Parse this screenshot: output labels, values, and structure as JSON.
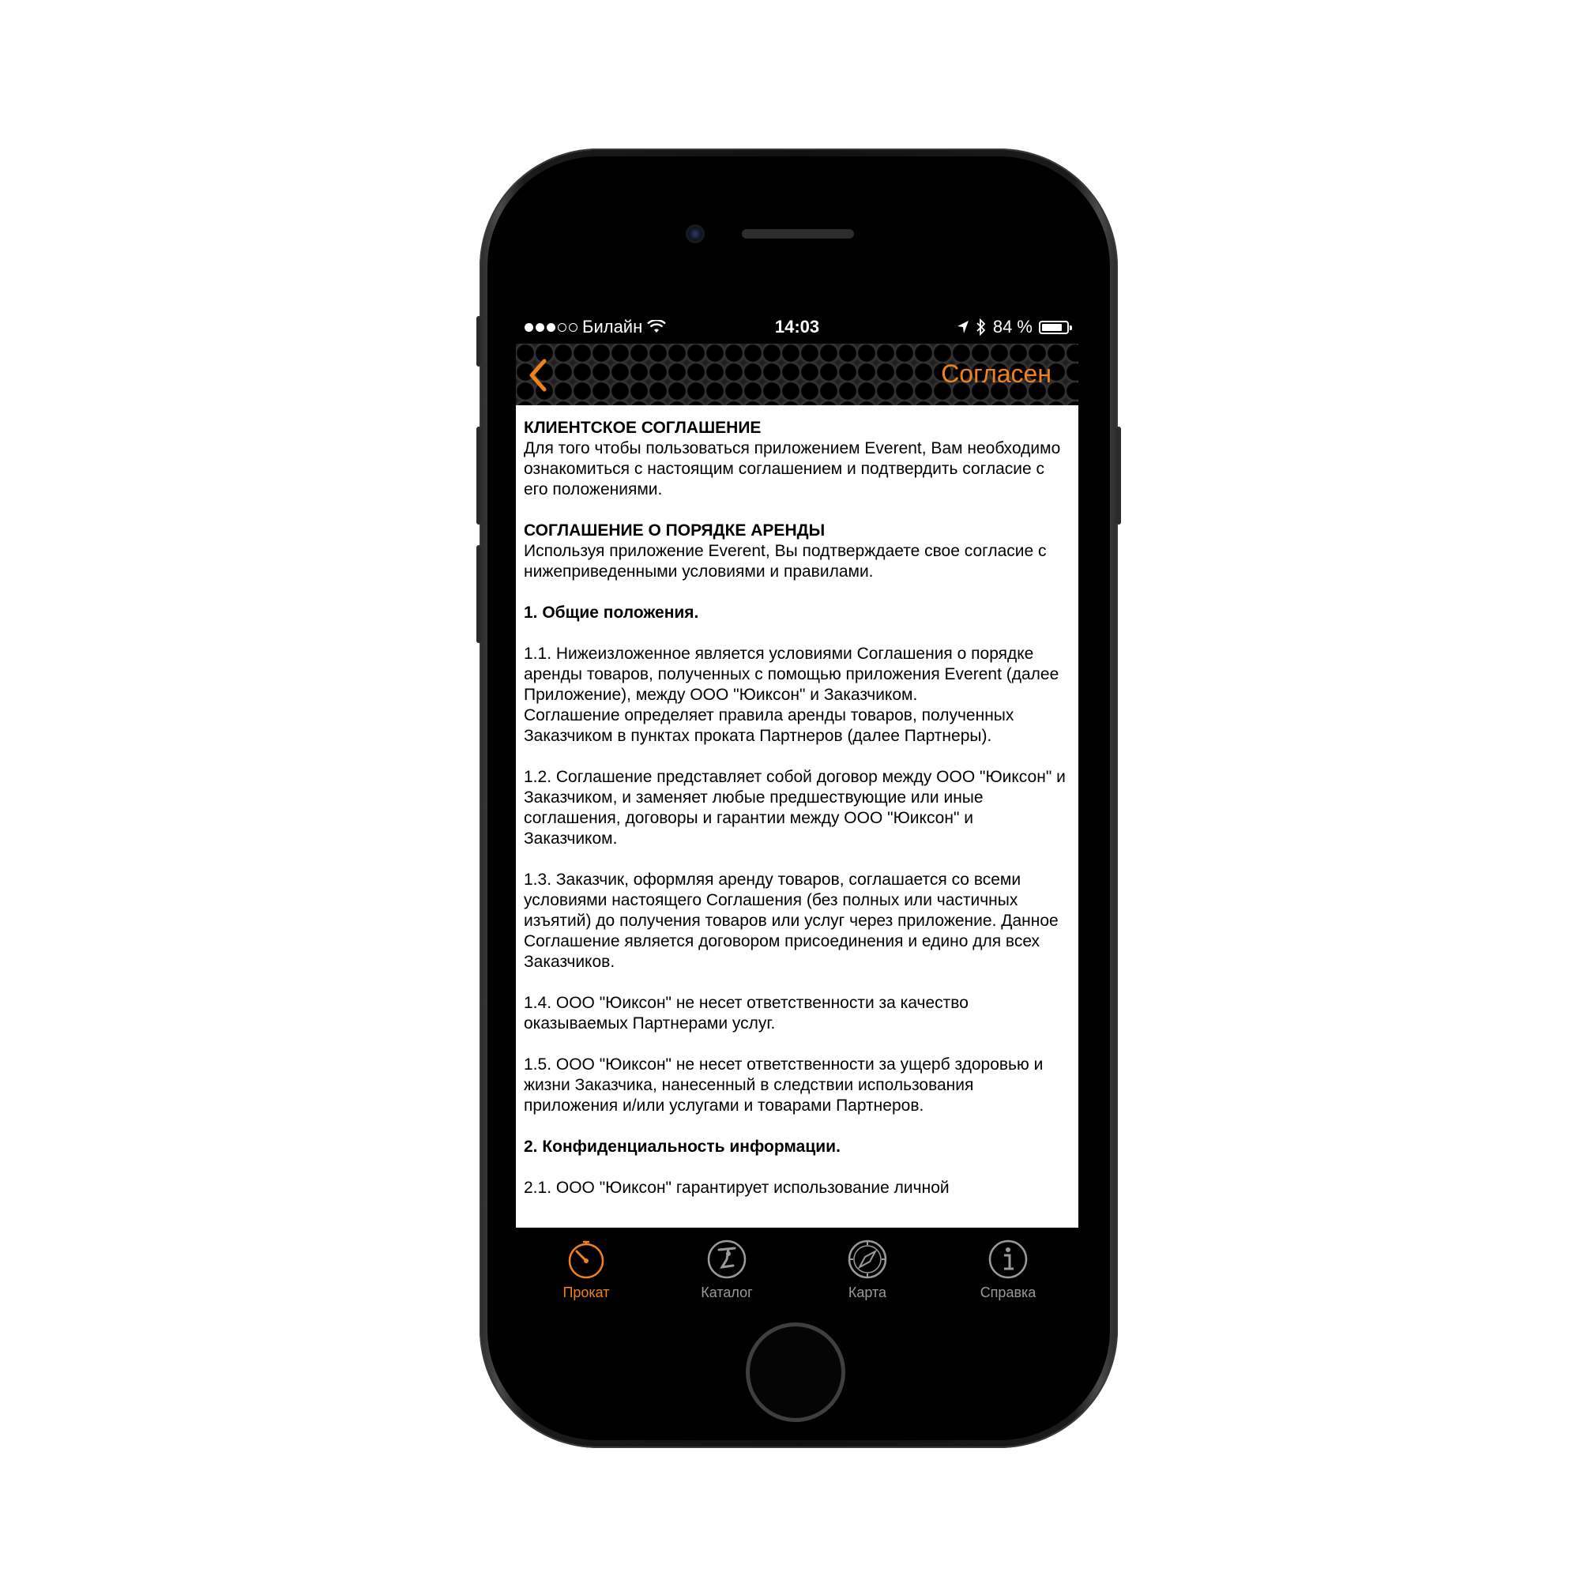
{
  "status_bar": {
    "carrier": "Билайн",
    "time": "14:03",
    "battery": "84 %",
    "battery_level": 0.84,
    "signal_bars": 3,
    "signal_total": 5
  },
  "nav": {
    "action_label": "Согласен",
    "accent_color": "#f0821e"
  },
  "agreement": {
    "title1": "КЛИЕНТСКОЕ СОГЛАШЕНИЕ",
    "intro1": "Для того чтобы пользоваться приложением Everent, Вам необходимо ознакомиться с настоящим соглашением и подтвердить согласие с его положениями.",
    "title2": "СОГЛАШЕНИЕ О ПОРЯДКЕ АРЕНДЫ",
    "intro2": "Используя приложение Everent, Вы подтверждаете свое согласие с нижеприведенными условиями и правилами.",
    "section1": "1. Общие положения.",
    "p1_1a": "1.1. Нижеизложенное является условиями Соглашения о порядке аренды товаров, полученных с помощью приложения Everent (далее Приложение), между ООО \"Юиксон\" и Заказчиком.",
    "p1_1b": "Соглашение определяет правила аренды товаров, полученных Заказчиком в пунктах проката Партнеров (далее Партнеры).",
    "p1_2": "1.2. Соглашение представляет собой договор между ООО \"Юиксон\" и Заказчиком, и заменяет любые предшествующие или иные соглашения, договоры и гарантии между ООО \"Юиксон\"  и Заказчиком.",
    "p1_3": "1.3. Заказчик, оформляя аренду товаров, соглашается со всеми условиями настоящего Соглашения (без полных или частичных изъятий) до получения товаров или услуг через приложение. Данное Соглашение является договором присоединения и едино для всех Заказчиков.",
    "p1_4": "1.4. ООО \"Юиксон\" не несет ответственности за качество оказываемых Партнерами услуг.",
    "p1_5": "1.5. ООО \"Юиксон\" не несет ответственности за ущерб здоровью и жизни Заказчика, нанесенный в следствии использования приложения и/или услугами и товарами Партнеров.",
    "section2": "2. Конфиденциальность информации.",
    "p2_1": "2.1. ООО \"Юиксон\" гарантирует использование личной"
  },
  "tabs": [
    {
      "label": "Прокат",
      "icon": "stopwatch-icon",
      "active": true
    },
    {
      "label": "Каталог",
      "icon": "ski-lift-icon",
      "active": false
    },
    {
      "label": "Карта",
      "icon": "compass-icon",
      "active": false
    },
    {
      "label": "Справка",
      "icon": "info-icon",
      "active": false
    }
  ]
}
